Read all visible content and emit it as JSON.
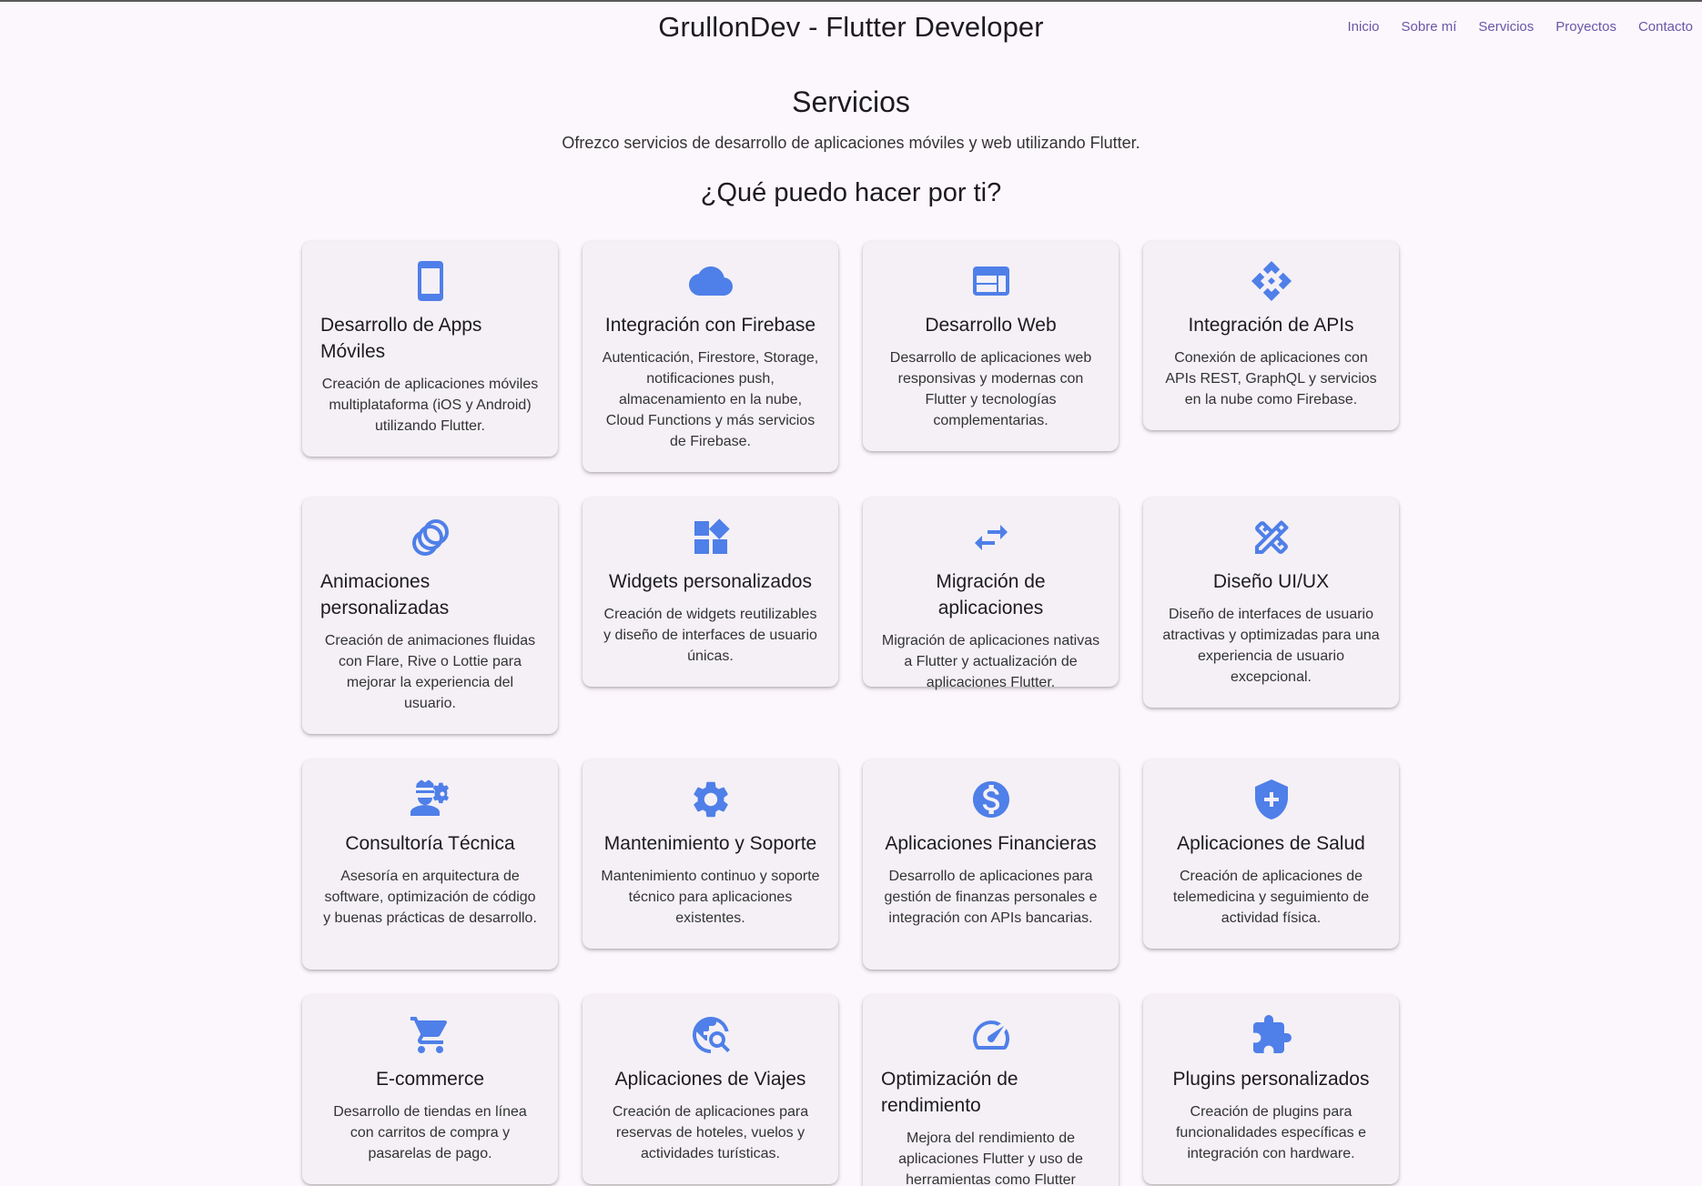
{
  "header": {
    "title": "GrullonDev - Flutter Developer",
    "nav": [
      "Inicio",
      "Sobre mí",
      "Servicios",
      "Proyectos",
      "Contacto"
    ]
  },
  "section": {
    "title": "Servicios",
    "description": "Ofrezco servicios de desarrollo de aplicaciones móviles y web utilizando Flutter.",
    "subtitle": "¿Qué puedo hacer por ti?"
  },
  "accent_color": "#4f7fe8",
  "cards": [
    {
      "icon": "phone-icon",
      "title": "Desarrollo de Apps Móviles",
      "text": "Creación de aplicaciones móviles multiplataforma (iOS y Android) utilizando Flutter."
    },
    {
      "icon": "cloud-icon",
      "title": "Integración con Firebase",
      "text": "Autenticación, Firestore, Storage, notificaciones push, almacenamiento en la nube, Cloud Functions y más servicios de Firebase."
    },
    {
      "icon": "web-icon",
      "title": "Desarrollo Web",
      "text": "Desarrollo de aplicaciones web responsivas y modernas con Flutter y tecnologías complementarias."
    },
    {
      "icon": "api-icon",
      "title": "Integración de APIs",
      "text": "Conexión de aplicaciones con APIs REST, GraphQL y servicios en la nube como Firebase."
    },
    {
      "icon": "animation-icon",
      "title": "Animaciones personalizadas",
      "text": "Creación de animaciones fluidas con Flare, Rive o Lottie para mejorar la experiencia del usuario."
    },
    {
      "icon": "widgets-icon",
      "title": "Widgets personalizados",
      "text": "Creación de widgets reutilizables y diseño de interfaces de usuario únicas."
    },
    {
      "icon": "swap-icon",
      "title": "Migración de aplicaciones",
      "text": "Migración de aplicaciones nativas a Flutter y actualización de aplicaciones Flutter."
    },
    {
      "icon": "design-icon",
      "title": "Diseño UI/UX",
      "text": "Diseño de interfaces de usuario atractivas y optimizadas para una experiencia de usuario excepcional."
    },
    {
      "icon": "engineer-icon",
      "title": "Consultoría Técnica",
      "text": "Asesoría en arquitectura de software, optimización de código y buenas prácticas de desarrollo."
    },
    {
      "icon": "gear-icon",
      "title": "Mantenimiento y Soporte",
      "text": "Mantenimiento continuo y soporte técnico para aplicaciones existentes."
    },
    {
      "icon": "dollar-icon",
      "title": "Aplicaciones Financieras",
      "text": "Desarrollo de aplicaciones para gestión de finanzas personales e integración con APIs bancarias."
    },
    {
      "icon": "health-shield-icon",
      "title": "Aplicaciones de Salud",
      "text": "Creación de aplicaciones de telemedicina y seguimiento de actividad física."
    },
    {
      "icon": "cart-icon",
      "title": "E-commerce",
      "text": "Desarrollo de tiendas en línea con carritos de compra y pasarelas de pago."
    },
    {
      "icon": "travel-explore-icon",
      "title": "Aplicaciones de Viajes",
      "text": "Creación de aplicaciones para reservas de hoteles, vuelos y actividades turísticas."
    },
    {
      "icon": "speed-icon",
      "title": "Optimización de rendimiento",
      "text": "Mejora del rendimiento de aplicaciones Flutter y uso de herramientas como Flutter DevTools."
    },
    {
      "icon": "puzzle-icon",
      "title": "Plugins personalizados",
      "text": "Creación de plugins para funcionalidades específicas e integración con hardware."
    }
  ]
}
